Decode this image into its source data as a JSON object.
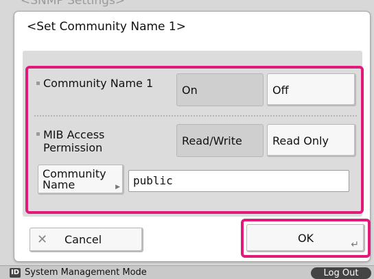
{
  "background_title": "<SNMP Settings>",
  "dialog": {
    "title": "<Set Community Name 1>"
  },
  "community_name_1": {
    "label": "Community Name 1",
    "options": [
      "On",
      "Off"
    ],
    "selected": "On"
  },
  "mib_access_permission": {
    "label_line1": "MIB Access",
    "label_line2": "Permission",
    "options": [
      "Read/Write",
      "Read Only"
    ],
    "selected": "Read/Write"
  },
  "community_name_field": {
    "button_line1": "Community",
    "button_line2": "Name",
    "value": "public"
  },
  "actions": {
    "cancel_label": "Cancel",
    "ok_label": "OK"
  },
  "status_bar": {
    "mode_icon_text": "ID",
    "mode_text": "System Management Mode",
    "logout_label": "Log Out"
  },
  "colors": {
    "highlight_frame": "#e0197a",
    "selected_option": "#cfcfcf"
  }
}
